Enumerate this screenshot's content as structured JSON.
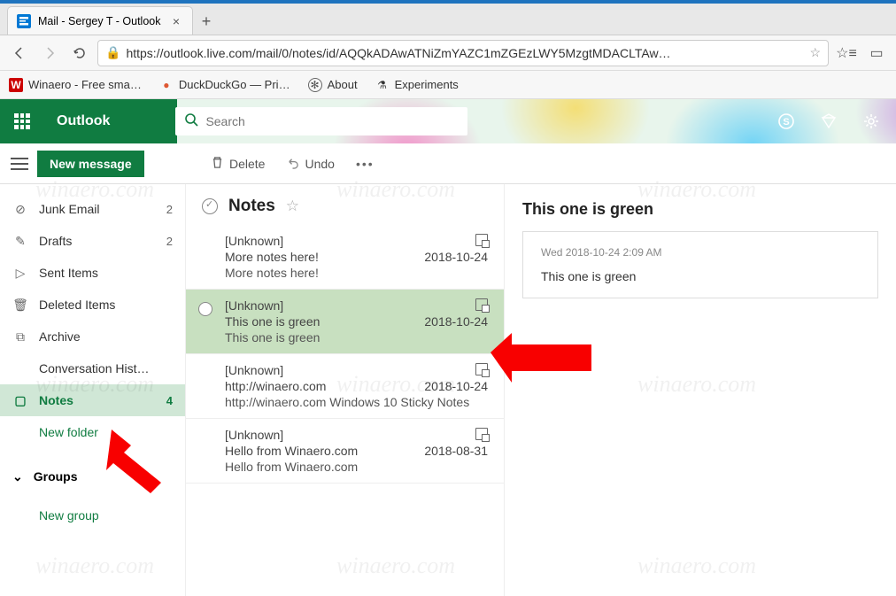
{
  "browser": {
    "tab_title": "Mail - Sergey T - Outlook",
    "url": "https://outlook.live.com/mail/0/notes/id/AQQkADAwATNiZmYAZC1mZGEzLWY5MzgtMDACLTAw…",
    "bookmarks": [
      {
        "label": "Winaero - Free sma…",
        "icon": "w"
      },
      {
        "label": "DuckDuckGo — Pri…",
        "icon": "d"
      },
      {
        "label": "About",
        "icon": "a"
      },
      {
        "label": "Experiments",
        "icon": "e"
      }
    ]
  },
  "app": {
    "brand": "Outlook",
    "search_placeholder": "Search",
    "new_message": "New message",
    "cmd_delete": "Delete",
    "cmd_undo": "Undo"
  },
  "folders": [
    {
      "icon": "⊘",
      "name": "Junk Email",
      "count": "2"
    },
    {
      "icon": "✎",
      "name": "Drafts",
      "count": "2"
    },
    {
      "icon": "▷",
      "name": "Sent Items",
      "count": ""
    },
    {
      "icon": "🗑",
      "name": "Deleted Items",
      "count": ""
    },
    {
      "icon": "⧉",
      "name": "Archive",
      "count": ""
    },
    {
      "icon": "",
      "name": "Conversation Hist…",
      "count": ""
    },
    {
      "icon": "▢",
      "name": "Notes",
      "count": "4",
      "selected": true
    }
  ],
  "new_folder_label": "New folder",
  "groups_label": "Groups",
  "new_group_label": "New group",
  "notelist": {
    "title": "Notes",
    "items": [
      {
        "from": "[Unknown]",
        "subject": "More notes here!",
        "preview": "More notes here!",
        "date": "2018-10-24"
      },
      {
        "from": "[Unknown]",
        "subject": "This one is green",
        "preview": "This one is green",
        "date": "2018-10-24",
        "selected": true
      },
      {
        "from": "[Unknown]",
        "subject": "http://winaero.com",
        "preview": "http://winaero.com Windows 10 Sticky Notes",
        "date": "2018-10-24"
      },
      {
        "from": "[Unknown]",
        "subject": "Hello from Winaero.com",
        "preview": "Hello from Winaero.com",
        "date": "2018-08-31"
      }
    ]
  },
  "reading": {
    "title": "This one is green",
    "date": "Wed 2018-10-24 2:09 AM",
    "body": "This one is green"
  },
  "watermark": "winaero.com"
}
